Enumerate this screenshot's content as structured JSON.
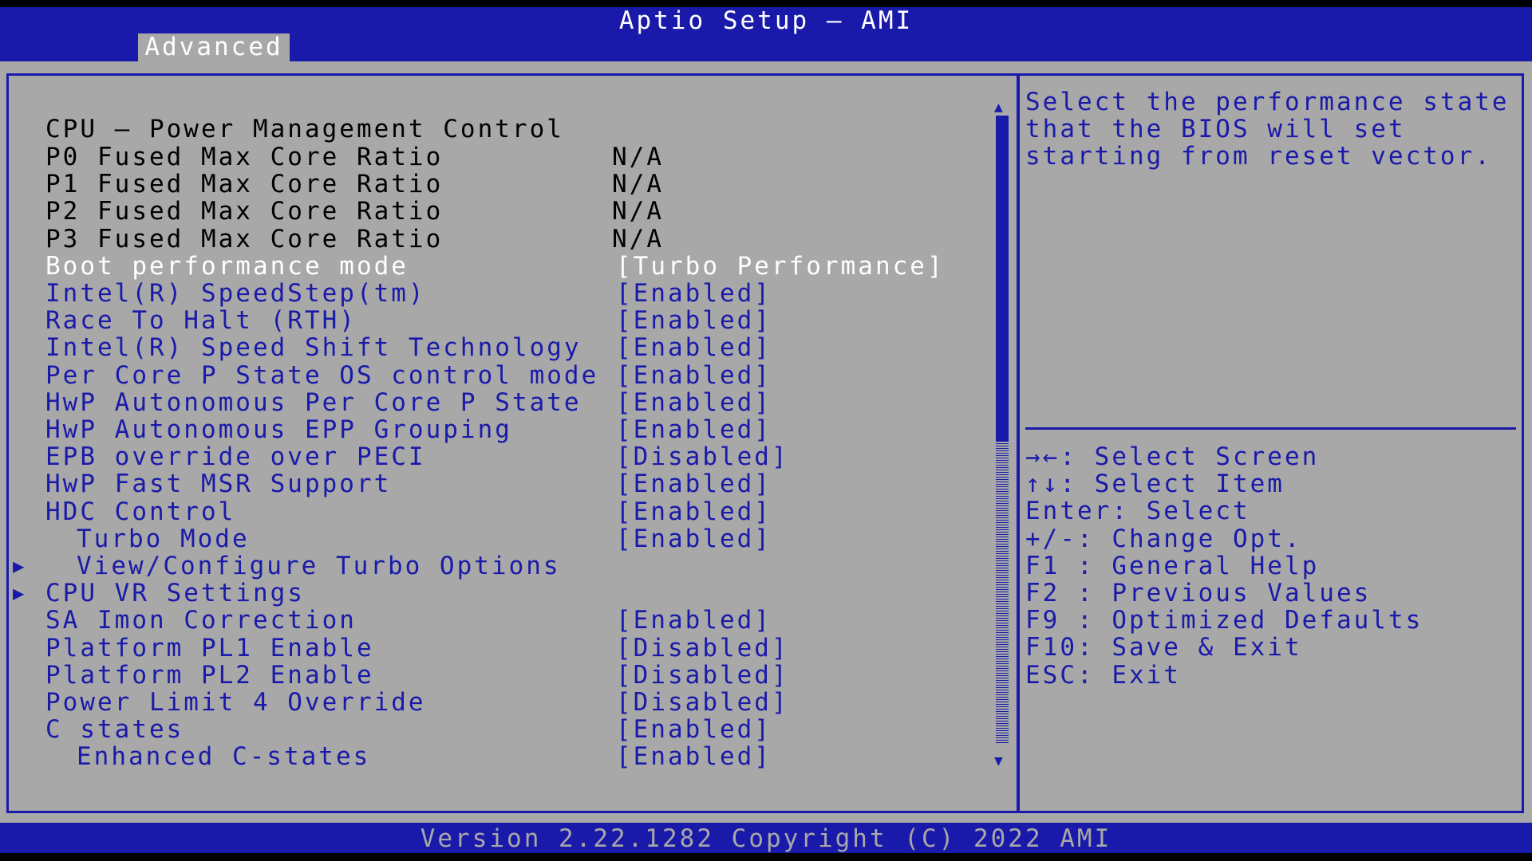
{
  "header": {
    "title": "Aptio Setup – AMI",
    "active_tab": "Advanced"
  },
  "page_title": "CPU – Power Management Control",
  "info_rows": [
    {
      "label": "P0 Fused Max Core Ratio",
      "value": "N/A"
    },
    {
      "label": "P1 Fused Max Core Ratio",
      "value": "N/A"
    },
    {
      "label": "P2 Fused Max Core Ratio",
      "value": "N/A"
    },
    {
      "label": "P3 Fused Max Core Ratio",
      "value": "N/A"
    }
  ],
  "settings": [
    {
      "label": "Boot performance mode",
      "value": "[Turbo Performance]",
      "selected": true
    },
    {
      "label": "Intel(R) SpeedStep(tm)",
      "value": "[Enabled]"
    },
    {
      "label": "Race To Halt (RTH)",
      "value": "[Enabled]"
    },
    {
      "label": "Intel(R) Speed Shift Technology",
      "value": "[Enabled]"
    },
    {
      "label": "Per Core P State OS control mode",
      "value": "[Enabled]"
    },
    {
      "label": "HwP Autonomous Per Core P State",
      "value": "[Enabled]"
    },
    {
      "label": "HwP Autonomous EPP Grouping",
      "value": "[Enabled]"
    },
    {
      "label": "EPB override over PECI",
      "value": "[Disabled]"
    },
    {
      "label": "HwP Fast MSR Support",
      "value": "[Enabled]"
    },
    {
      "label": "HDC Control",
      "value": "[Enabled]"
    },
    {
      "label": "Turbo Mode",
      "value": "[Enabled]",
      "indent": true
    },
    {
      "label": "View/Configure Turbo Options",
      "value": "",
      "submenu": true,
      "indent": true
    },
    {
      "label": "CPU VR Settings",
      "value": "",
      "submenu": true
    },
    {
      "label": "SA Imon Correction",
      "value": "[Enabled]"
    },
    {
      "label": "Platform PL1 Enable",
      "value": "[Disabled]"
    },
    {
      "label": "Platform PL2 Enable",
      "value": "[Disabled]"
    },
    {
      "label": "Power Limit 4 Override",
      "value": "[Disabled]"
    },
    {
      "label": "C states",
      "value": "[Enabled]"
    },
    {
      "label": "Enhanced C-states",
      "value": "[Enabled]",
      "indent": true
    }
  ],
  "help_text": [
    "Select the performance state",
    "that the BIOS will set",
    "starting from reset vector."
  ],
  "key_legend": [
    "→←: Select Screen",
    "↑↓: Select Item",
    "Enter: Select",
    "+/-: Change Opt.",
    "F1 : General Help",
    "F2 : Previous Values",
    "F9 : Optimized Defaults",
    "F10: Save & Exit",
    "ESC: Exit"
  ],
  "footer": {
    "version": "Version 2.22.1282 Copyright (C) 2022 AMI"
  },
  "scroll": {
    "visible_fraction": 0.52
  },
  "colors": {
    "bios_blue": "#1a1aaa",
    "bios_gray": "#a8a8a8",
    "highlight": "#ffffff"
  }
}
